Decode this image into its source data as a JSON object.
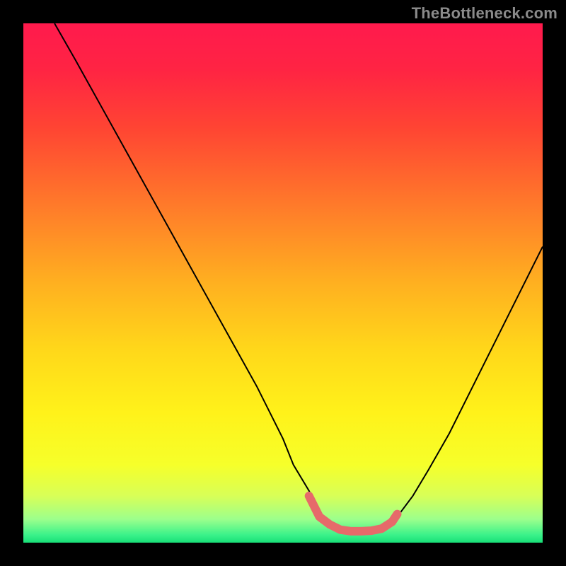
{
  "watermark": "TheBottleneck.com",
  "gradient_stops": [
    {
      "offset": 0.0,
      "color": "#ff1a4d"
    },
    {
      "offset": 0.09,
      "color": "#ff2443"
    },
    {
      "offset": 0.2,
      "color": "#ff4433"
    },
    {
      "offset": 0.35,
      "color": "#ff7a2a"
    },
    {
      "offset": 0.5,
      "color": "#ffb020"
    },
    {
      "offset": 0.63,
      "color": "#ffd81a"
    },
    {
      "offset": 0.75,
      "color": "#fff21a"
    },
    {
      "offset": 0.85,
      "color": "#f6ff2a"
    },
    {
      "offset": 0.91,
      "color": "#d8ff57"
    },
    {
      "offset": 0.955,
      "color": "#9cff8c"
    },
    {
      "offset": 0.985,
      "color": "#3bf28a"
    },
    {
      "offset": 1.0,
      "color": "#18e078"
    }
  ],
  "chart_data": {
    "type": "line",
    "title": "",
    "xlabel": "",
    "ylabel": "",
    "xlim": [
      0,
      100
    ],
    "ylim": [
      0,
      100
    ],
    "legend": false,
    "grid": false,
    "series": [
      {
        "name": "bottleneck-curve",
        "color": "#000000",
        "x": [
          6,
          10,
          15,
          20,
          25,
          30,
          35,
          40,
          45,
          50,
          52,
          55,
          57,
          58,
          60,
          62,
          64,
          66,
          68,
          70,
          72,
          75,
          78,
          82,
          86,
          90,
          94,
          98,
          100
        ],
        "y": [
          100,
          93,
          84,
          75,
          66,
          57,
          48,
          39,
          30,
          20,
          15,
          10,
          6,
          4,
          3,
          2,
          2,
          2,
          2,
          3,
          5,
          9,
          14,
          21,
          29,
          37,
          45,
          53,
          57
        ]
      },
      {
        "name": "flat-highlight",
        "color": "#e66a6a",
        "stroke_width": 12,
        "linecap": "round",
        "x": [
          55,
          57,
          59,
          61,
          63,
          65,
          67,
          69,
          71,
          72
        ],
        "y": [
          9,
          5,
          3.5,
          2.5,
          2.2,
          2.2,
          2.3,
          2.7,
          4.0,
          5.5
        ]
      }
    ]
  }
}
